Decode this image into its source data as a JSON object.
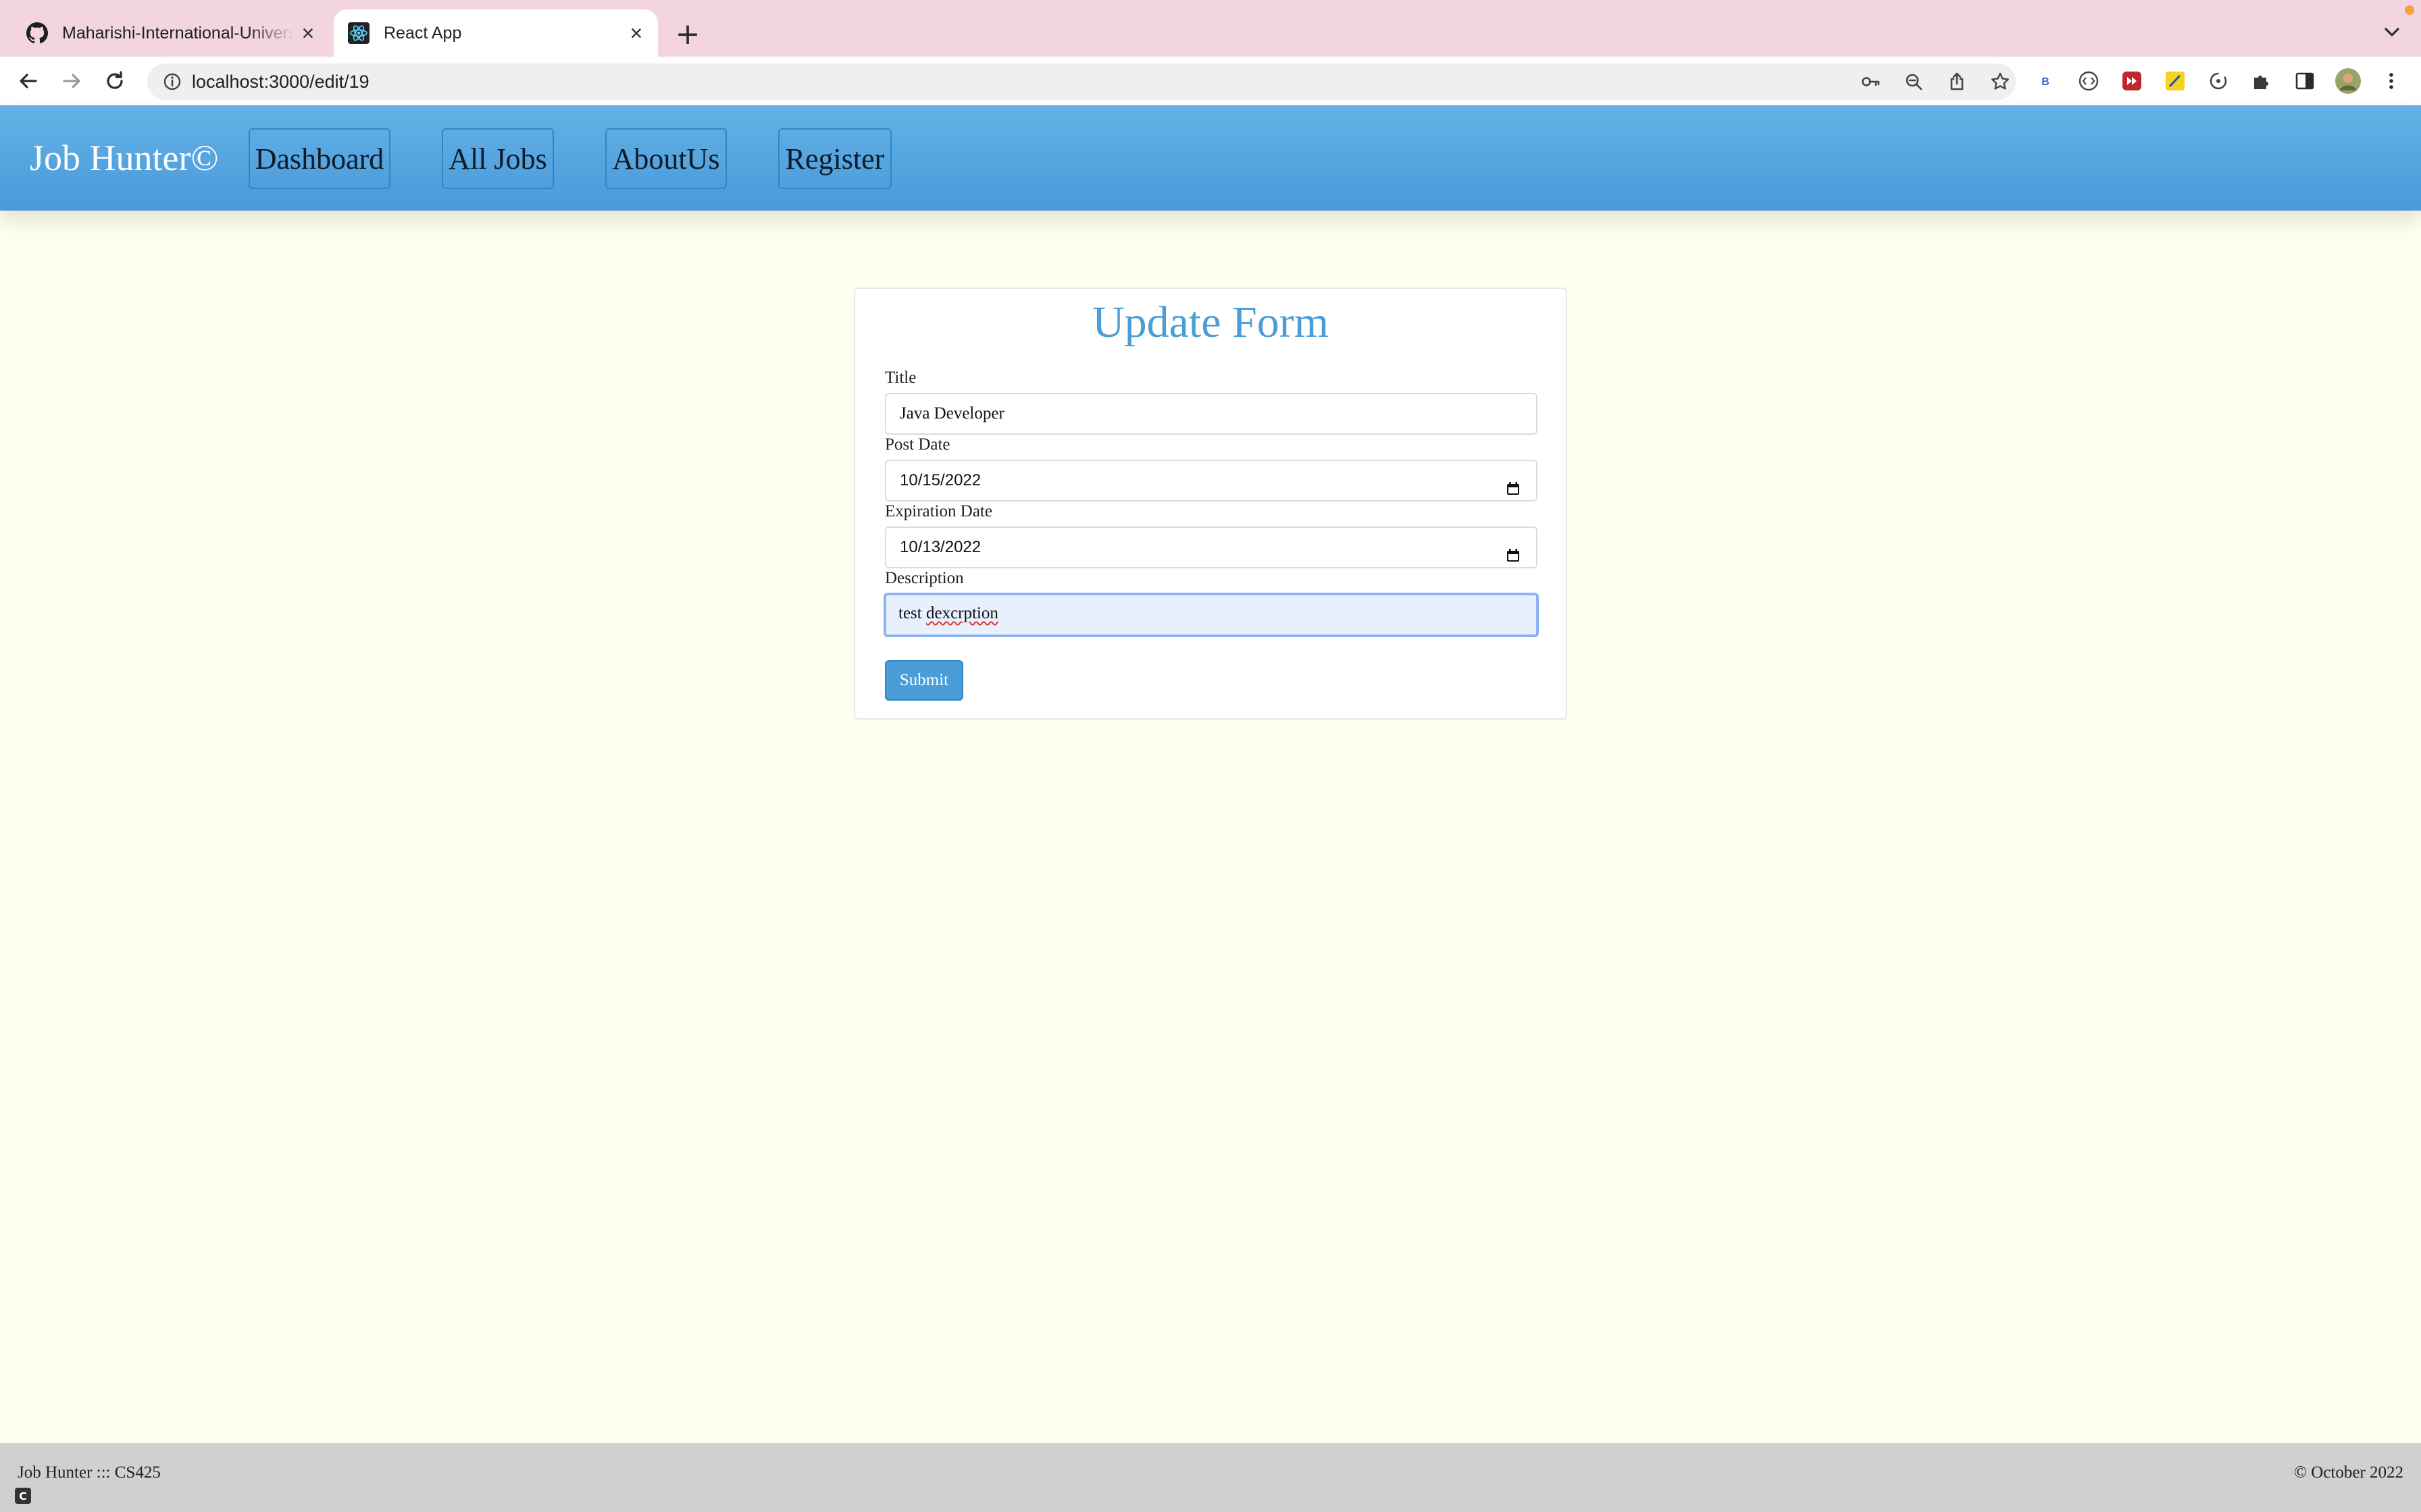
{
  "browser": {
    "tabs": [
      {
        "title": "Maharishi-International-University",
        "favicon": "github-icon",
        "active": false
      },
      {
        "title": "React App",
        "favicon": "react-icon",
        "active": true
      }
    ],
    "address": "localhost:3000/edit/19",
    "extensions": [
      "bitwarden-icon",
      "code-icon",
      "media-icon",
      "note-icon",
      "sync-icon",
      "puzzle-icon",
      "sidepanel-icon",
      "profile-avatar"
    ]
  },
  "app": {
    "brand": "Job Hunter©",
    "nav": {
      "dashboard": "Dashboard",
      "all_jobs": "All Jobs",
      "about_us": "AboutUs",
      "register": "Register"
    }
  },
  "form": {
    "heading": "Update Form",
    "title_label": "Title",
    "title_value": "Java Developer",
    "post_date_label": "Post Date",
    "post_date_value": "10/15/2022",
    "expiration_date_label": "Expiration Date",
    "expiration_date_value": "10/13/2022",
    "description_label": "Description",
    "description_value_prefix": "test ",
    "description_value_word": "dexcrption",
    "submit_label": "Submit"
  },
  "footer": {
    "left": "Job Hunter ::: CS425",
    "right": "© October 2022"
  },
  "colors": {
    "page_bg": "#fefff0",
    "navbar": "#4a99d9",
    "accent": "#4a9dd6",
    "tabbar": "#f2d5e1",
    "footer": "#d0d0d0"
  }
}
